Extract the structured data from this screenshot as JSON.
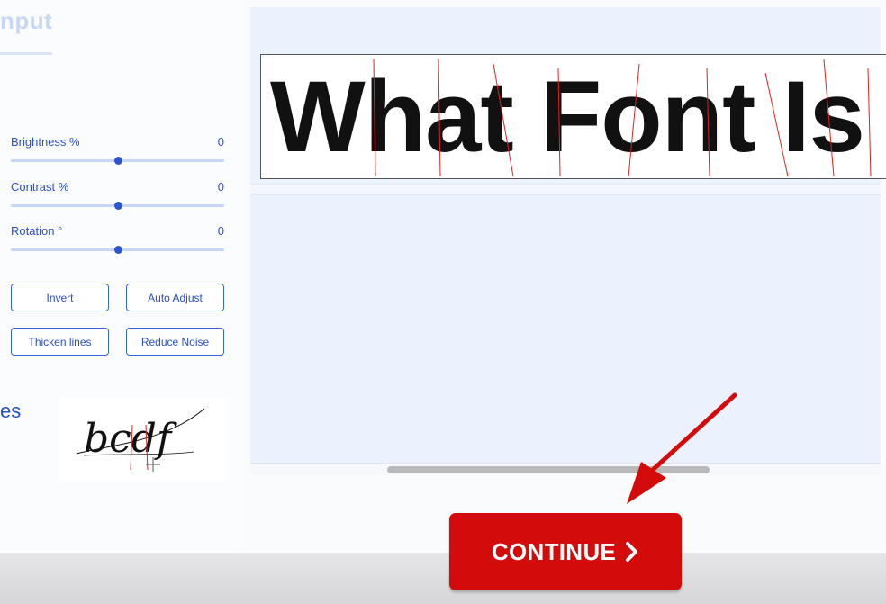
{
  "panel": {
    "title_fragment": "nput"
  },
  "sliders": [
    {
      "label": "Brightness %",
      "value": "0",
      "level": 0.5
    },
    {
      "label": "Contrast %",
      "value": "0",
      "level": 0.5
    },
    {
      "label": "Rotation °",
      "value": "0",
      "level": 0.5
    }
  ],
  "actions": {
    "invert": "Invert",
    "auto_adjust": "Auto Adjust",
    "thicken_lines": "Thicken lines",
    "reduce_noise": "Reduce Noise"
  },
  "section_fragment": "es",
  "sample_thumbnail_text": "bcdf",
  "preview": {
    "sample_text": "What Font Is"
  },
  "continue_button": {
    "label": "CONTINUE"
  },
  "colors": {
    "accent": "#2a54d6",
    "continue_bg": "#d30b0b",
    "arrow": "#d30b0b"
  }
}
